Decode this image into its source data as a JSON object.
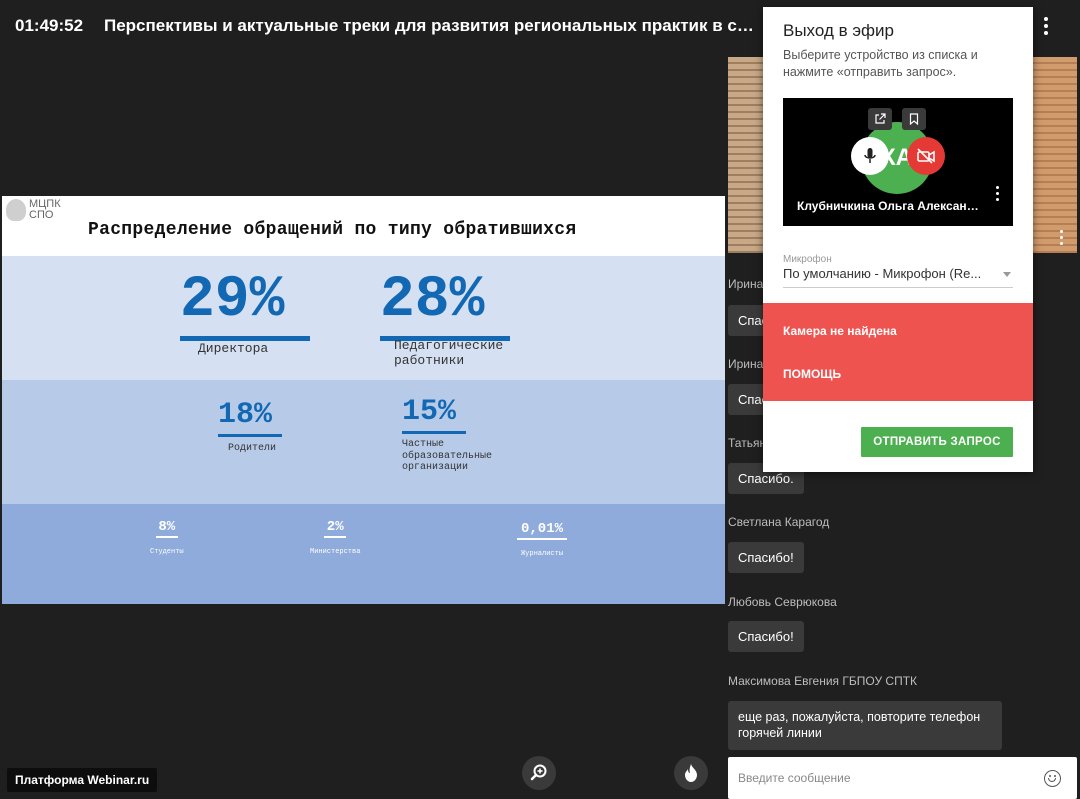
{
  "header": {
    "timer": "01:49:52",
    "title": "Перспективы и актуальные треки для развития региональных практик в сис..."
  },
  "slide": {
    "logo_text": "МЦПК СПО",
    "title": "Распределение обращений по типу обратившихся",
    "stats": [
      {
        "value": "29%",
        "label": "Директора"
      },
      {
        "value": "28%",
        "label": "Педагогические работники"
      },
      {
        "value": "18%",
        "label": "Родители"
      },
      {
        "value": "15%",
        "label": "Частные образовательные организации"
      },
      {
        "value": "8%",
        "label": "Студенты"
      },
      {
        "value": "2%",
        "label": "Министерства"
      },
      {
        "value": "0,01%",
        "label": "Журналисты"
      }
    ]
  },
  "dialog": {
    "title": "Выход в эфир",
    "description": "Выберите устройство из списка и нажмите «отправить запрос».",
    "avatar_initials": "КА",
    "preview_name": "Клубничкина Ольга Александ...",
    "mic_label": "Микрофон",
    "mic_value": "По умолчанию - Микрофон (Re...",
    "error_text": "Камера не найдена",
    "help_label": "ПОМОЩЬ",
    "send_label": "ОТПРАВИТЬ ЗАПРОС"
  },
  "chat": {
    "messages": [
      {
        "author": "Ирина",
        "text": "Спасибо!"
      },
      {
        "author": "Ирина",
        "text": "Спасибо!"
      },
      {
        "author": "Татьяна",
        "text": "Спасибо."
      },
      {
        "author": "Светлана Карагод",
        "text": "Спасибо!"
      },
      {
        "author": "Любовь Севрюкова",
        "text": "Спасибо!"
      },
      {
        "author": "Максимова Евгения ГБПОУ СПТК",
        "text": "еще раз, пожалуйста,  повторите телефон горячей линии"
      }
    ],
    "input_placeholder": "Введите сообщение"
  },
  "footer": {
    "brand": "Платформа Webinar.ru"
  }
}
